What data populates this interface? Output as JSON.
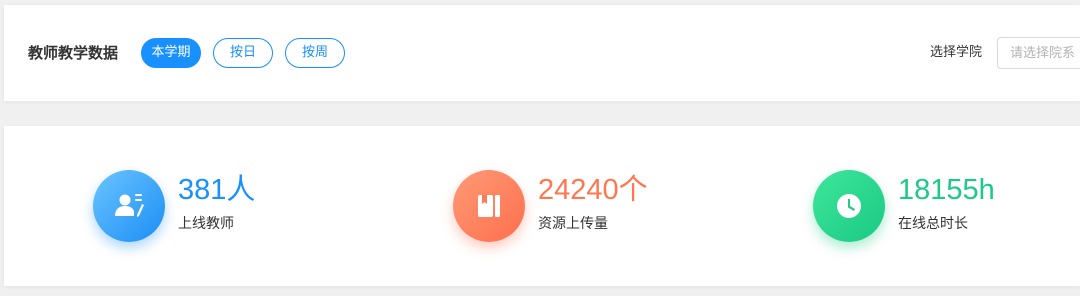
{
  "header": {
    "title": "教师教学数据",
    "filters": [
      {
        "label": "本学期",
        "active": true
      },
      {
        "label": "按日",
        "active": false
      },
      {
        "label": "按周",
        "active": false
      }
    ],
    "college_label": "选择学院",
    "college_placeholder": "请选择院系"
  },
  "stats": [
    {
      "value": "381人",
      "label": "上线教师",
      "icon": "teacher-icon",
      "color": "#1890ff"
    },
    {
      "value": "24240个",
      "label": "资源上传量",
      "icon": "book-icon",
      "color": "#ff7650"
    },
    {
      "value": "18155h",
      "label": "在线总时长",
      "icon": "clock-icon",
      "color": "#1ec888"
    }
  ]
}
